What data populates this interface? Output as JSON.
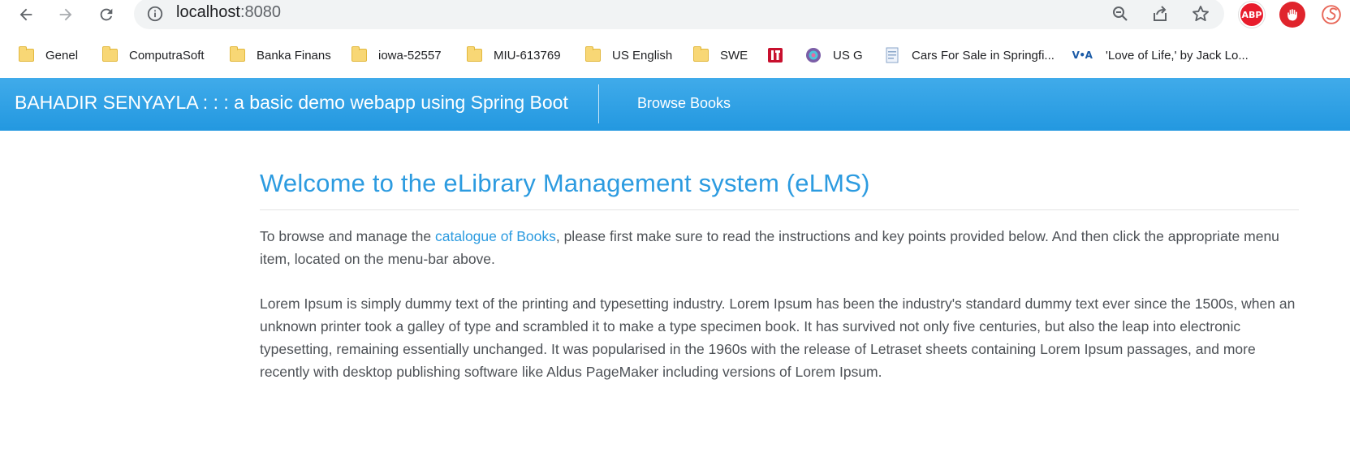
{
  "browser": {
    "url_host": "localhost",
    "url_port": ":8080",
    "extensions": {
      "abp_label": "ABP"
    },
    "bookmarks": [
      {
        "label": "Genel",
        "icon": "folder-icon"
      },
      {
        "label": "ComputraSoft",
        "icon": "folder-icon"
      },
      {
        "label": "Banka Finans",
        "icon": "folder-icon"
      },
      {
        "label": "iowa-52557",
        "icon": "folder-icon"
      },
      {
        "label": "MIU-613769",
        "icon": "folder-icon"
      },
      {
        "label": "US English",
        "icon": "folder-icon"
      },
      {
        "label": "SWE",
        "icon": "folder-icon"
      },
      {
        "label": "",
        "icon": "red-site-icon"
      },
      {
        "label": "US G",
        "icon": "flower-icon"
      },
      {
        "label": "Cars For Sale in Springfi...",
        "icon": "document-icon"
      },
      {
        "label": "'Love of Life,' by Jack Lo...",
        "icon": "voa-icon"
      }
    ]
  },
  "header": {
    "brand": "BAHADIR SENYAYLA : : : a basic demo webapp using Spring Boot",
    "nav_browse_books": "Browse Books",
    "color": "#2c9be0"
  },
  "main": {
    "title": "Welcome to the eLibrary Management system (eLMS)",
    "intro_before": "To browse and manage the ",
    "intro_link": "catalogue of Books",
    "intro_after": ", please first make sure to read the instructions and key points provided below. And then click the appropriate menu item, located on the menu-bar above.",
    "lorem": "Lorem Ipsum is simply dummy text of the printing and typesetting industry. Lorem Ipsum has been the industry's standard dummy text ever since the 1500s, when an unknown printer took a galley of type and scrambled it to make a type specimen book. It has survived not only five centuries, but also the leap into electronic typesetting, remaining essentially unchanged. It was popularised in the 1960s with the release of Letraset sheets containing Lorem Ipsum passages, and more recently with desktop publishing software like Aldus PageMaker including versions of Lorem Ipsum."
  }
}
